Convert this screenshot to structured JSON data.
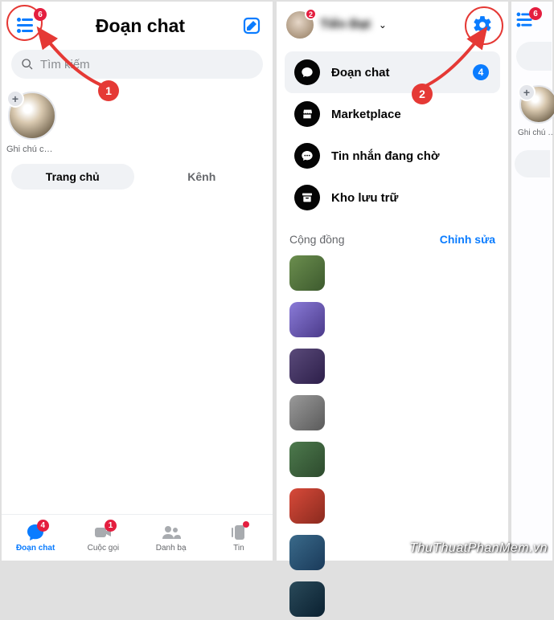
{
  "left": {
    "title": "Đoạn chat",
    "menu_badge": "6",
    "search_placeholder": "Tìm kiếm",
    "story_name": "Ghi chú của b...",
    "segment": {
      "home": "Trang chủ",
      "channel": "Kênh"
    },
    "tabs": {
      "chat": {
        "label": "Đoạn chat",
        "badge": "4"
      },
      "calls": {
        "label": "Cuộc gọi",
        "badge": "1"
      },
      "contacts": {
        "label": "Danh bạ"
      },
      "news": {
        "label": "Tin"
      }
    }
  },
  "mid": {
    "profile_name": "Tiến Đạt",
    "profile_badge": "2",
    "menu": [
      {
        "icon": "chat",
        "label": "Đoạn chat",
        "badge": "4",
        "active": true
      },
      {
        "icon": "store",
        "label": "Marketplace"
      },
      {
        "icon": "pending",
        "label": "Tin nhắn đang chờ"
      },
      {
        "icon": "archive",
        "label": "Kho lưu trữ"
      }
    ],
    "community": {
      "title": "Cộng đồng",
      "edit": "Chỉnh sửa"
    },
    "community_colors": [
      "#4a7c3a",
      "#6a5acd",
      "#4b3a6b",
      "#6b6b6b",
      "#3d5a3d",
      "#c0392b",
      "#2c5f7c",
      "#1a3a4a"
    ]
  },
  "right": {
    "menu_badge": "6",
    "story_name": "Ghi chú của b..."
  },
  "annotations": {
    "step1": "1",
    "step2": "2"
  },
  "watermark": "ThuThuatPhanMem.vn"
}
